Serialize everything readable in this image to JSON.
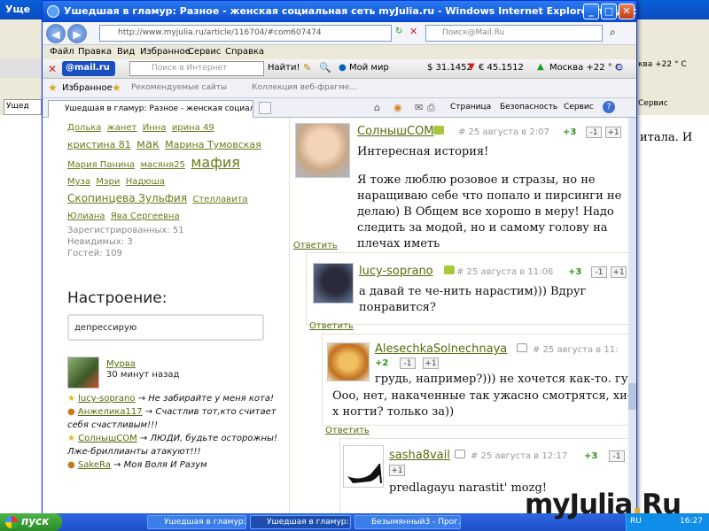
{
  "bg_window": {
    "title": "Уще",
    "tab": "Ущед",
    "right_weather": "ква +22 ° C",
    "right_service": "Сервис",
    "right_text": "итала. И"
  },
  "window": {
    "title": "Ушедшая в гламур: Разное - женская социальная сеть myJulia.ru - Windows Internet Explorer предоставлен: Mail.Ru",
    "address": "http://www.myjulia.ru/article/116704/#com607474",
    "search_placeholder": "Поиск@Mail.Ru",
    "menu": [
      "Файл",
      "Правка",
      "Вид",
      "Избранное",
      "Сервис",
      "Справка"
    ]
  },
  "mailbar": {
    "logo": "@mail.ru",
    "search_placeholder": "Поиск в Интернет",
    "find": "Найти!",
    "myworld": "Мой мир",
    "usd": "$ 31.1452",
    "eur": "€ 45.1512",
    "weather": "Москва +22 ° C"
  },
  "favbar": {
    "favorites": "Избранное",
    "recommended": "Рекомендуемые сайты",
    "collection": "Коллекция веб-фрагме..."
  },
  "tabbar": {
    "tab_title": "Ушедшая в гламур: Разное - женская социальная ...",
    "page": "Страница",
    "safety": "Безопасность",
    "service": "Сервис"
  },
  "tags": [
    [
      "Долька",
      "жанет",
      "Инна",
      "ирина 49"
    ],
    [
      "кристина 81",
      "мак",
      "Марина Тумовская"
    ],
    [
      "Мария Панина",
      "масяня25",
      "мафия"
    ],
    [
      "Муза",
      "Мэри",
      "Надюша"
    ],
    [
      "Скопинцева Зульфия",
      "Стеллавита"
    ],
    [
      "Юлиана",
      "Ява Сергеевна"
    ]
  ],
  "stats": {
    "registered": "Зарегистрированных: 51",
    "invisible": "Невидимых: 3",
    "guests": "Гостей: 109"
  },
  "mood": {
    "heading": "Настроение:",
    "input_value": "депрессирую",
    "user": "Мурва",
    "time": "30 минут назад"
  },
  "statuses": [
    {
      "user": "lucy-soprano",
      "text": "→ Не забирайте у меня кота!"
    },
    {
      "user": "Анжелика117",
      "text": "→ Счастлив тот,кто считает себя счастливым!!!"
    },
    {
      "user": "СолнышСОМ",
      "text": "→ ЛЮДИ, будьте осторожны! Лже-бриллианты атакуют!!!"
    },
    {
      "user": "SakeRa",
      "text": "→ Моя Воля И Разум"
    }
  ],
  "comments": [
    {
      "user": "СолнышСОМ",
      "date": "# 25 августа в 2:07",
      "score": "+3",
      "text1": "Интересная история!",
      "text2": "Я тоже люблю розовое и стразы, но не наращиваю себе что попало и пирсинги не делаю) В Общем все хорошо в меру! Надо следить за модой, но и самому голову на плечах иметь",
      "reply": "Ответить"
    },
    {
      "user": "lucy-soprano",
      "date": "# 25 августа в 11:06",
      "score": "+3",
      "text1": "а давай те че-нить нарастим))) Вдруг понравится?",
      "reply": "Ответить"
    },
    {
      "user": "AlesechkaSolnechnaya",
      "date": "# 25 августа в 11:",
      "score": "+2",
      "text1": "грудь, например?))) не хочется как-то. губ",
      "text2": "Ооо, нет, накаченные так ужасно смотрятся, хи-х ногти? только за))",
      "reply": "Ответить"
    },
    {
      "user": "sasha8vail",
      "date": "# 25 августа в 12:17",
      "score": "+3",
      "text1": "predlagayu narastit' mozg!"
    }
  ],
  "vote": {
    "minus": "-1",
    "plus": "+1"
  },
  "taskbar": {
    "start": "пуск",
    "items": [
      "Ушедшая в гламур: ...",
      "Ушедшая в гламур: ...",
      "Безымянный3 - Прог..."
    ],
    "lang": "RU",
    "clock": "16:27"
  },
  "watermark": {
    "a": "myJulia",
    "dot": ".",
    "b": "Ru"
  }
}
